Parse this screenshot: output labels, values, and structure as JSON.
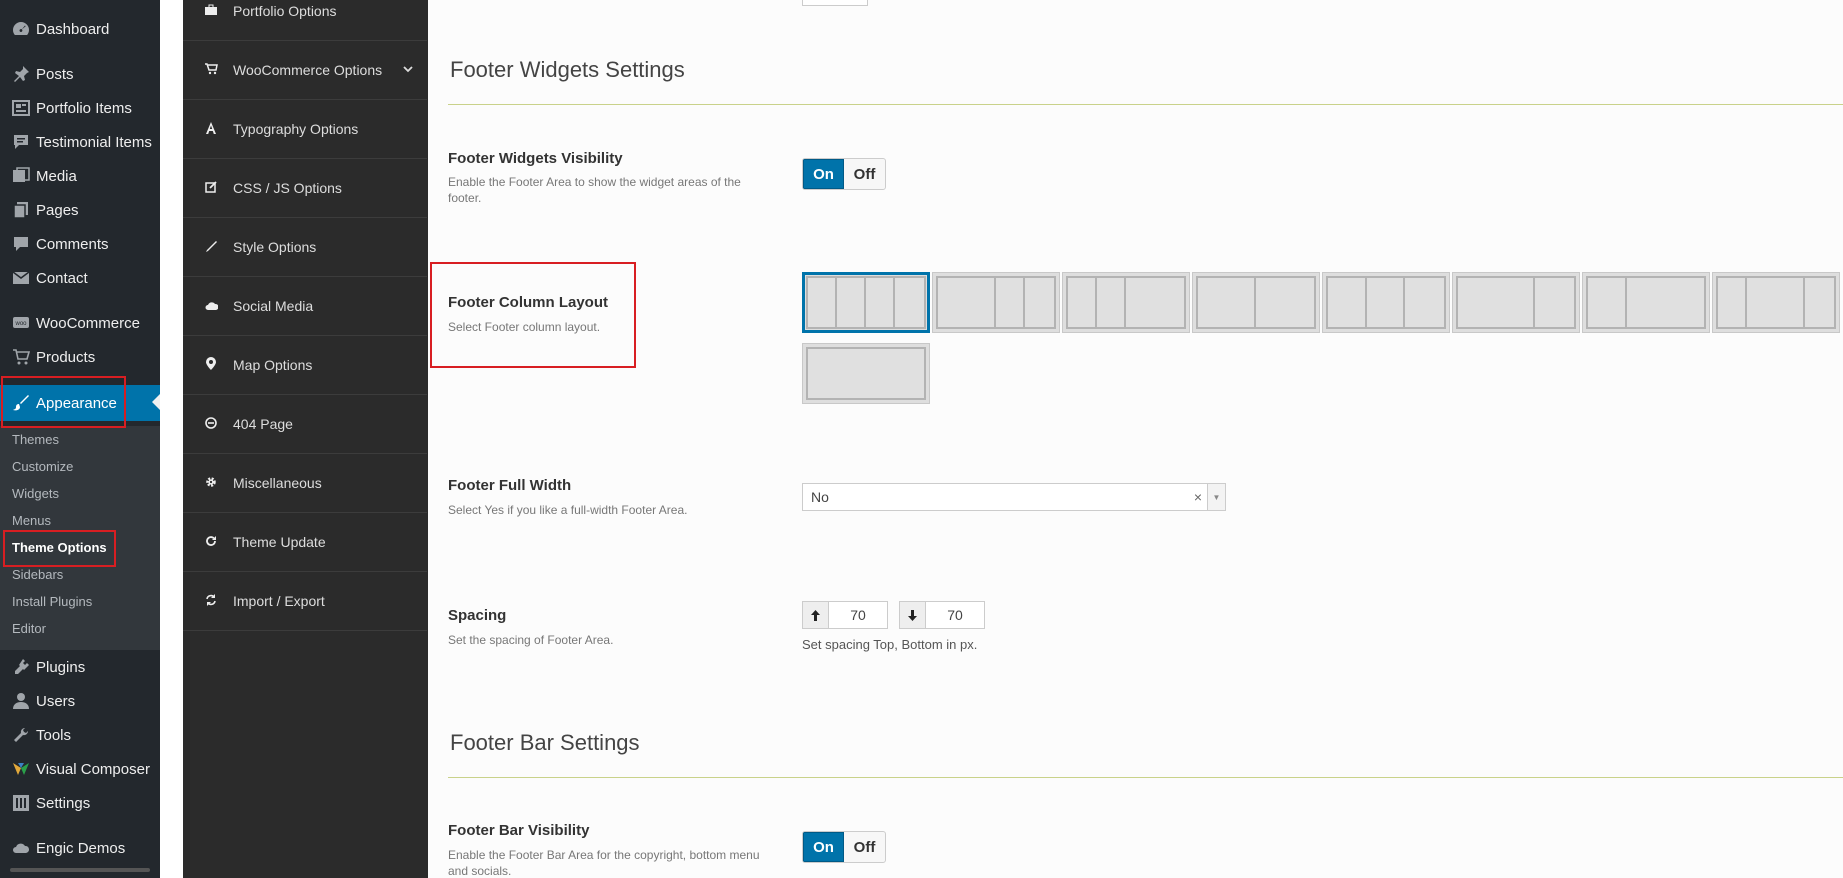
{
  "admin_menu": {
    "items": [
      {
        "label": "Dashboard",
        "icon": "dashboard-icon"
      },
      {
        "label": "Posts",
        "icon": "pin-icon"
      },
      {
        "label": "Portfolio Items",
        "icon": "portfolio-icon"
      },
      {
        "label": "Testimonial Items",
        "icon": "testimonial-icon"
      },
      {
        "label": "Media",
        "icon": "media-icon"
      },
      {
        "label": "Pages",
        "icon": "pages-icon"
      },
      {
        "label": "Comments",
        "icon": "comments-icon"
      },
      {
        "label": "Contact",
        "icon": "mail-icon"
      },
      {
        "label": "WooCommerce",
        "icon": "woo-icon"
      },
      {
        "label": "Products",
        "icon": "cart-icon"
      },
      {
        "label": "Appearance",
        "icon": "brush-icon"
      },
      {
        "label": "Plugins",
        "icon": "plug-icon"
      },
      {
        "label": "Users",
        "icon": "user-icon"
      },
      {
        "label": "Tools",
        "icon": "wrench-icon"
      },
      {
        "label": "Visual Composer",
        "icon": "vc-icon"
      },
      {
        "label": "Settings",
        "icon": "settings-icon"
      },
      {
        "label": "Engic Demos",
        "icon": "cloud-icon"
      }
    ],
    "submenu": [
      "Themes",
      "Customize",
      "Widgets",
      "Menus",
      "Theme Options",
      "Sidebars",
      "Install Plugins",
      "Editor"
    ],
    "active_item": "Appearance",
    "current_sub": "Theme Options"
  },
  "options_nav": [
    {
      "label": "Portfolio Options",
      "icon": "briefcase-icon"
    },
    {
      "label": "WooCommerce Options",
      "icon": "cart-icon",
      "has_children": true
    },
    {
      "label": "Typography Options",
      "icon": "font-icon"
    },
    {
      "label": "CSS / JS Options",
      "icon": "edit-icon"
    },
    {
      "label": "Style Options",
      "icon": "pencil-icon"
    },
    {
      "label": "Social Media",
      "icon": "cloud-icon"
    },
    {
      "label": "Map Options",
      "icon": "map-marker-icon"
    },
    {
      "label": "404 Page",
      "icon": "minus-circle-icon"
    },
    {
      "label": "Miscellaneous",
      "icon": "gear-icon"
    },
    {
      "label": "Theme Update",
      "icon": "refresh-icon"
    },
    {
      "label": "Import / Export",
      "icon": "sync-icon"
    }
  ],
  "sections": {
    "footer_widgets": {
      "title": "Footer Widgets Settings",
      "visibility": {
        "title": "Footer Widgets Visibility",
        "desc": "Enable the Footer Area to show the widget areas of the footer.",
        "on_label": "On",
        "off_label": "Off",
        "value": "On"
      },
      "column_layout": {
        "title": "Footer Column Layout",
        "desc": "Select Footer column layout.",
        "selected_index": 0
      },
      "full_width": {
        "title": "Footer Full Width",
        "desc": "Select Yes if you like a full-width Footer Area.",
        "value": "No",
        "clear_icon": "×",
        "arrow_icon": "▼"
      },
      "spacing": {
        "title": "Spacing",
        "desc": "Set the spacing of Footer Area.",
        "top": "70",
        "bottom": "70",
        "hint": "Set spacing Top, Bottom in px."
      }
    },
    "footer_bar": {
      "title": "Footer Bar Settings",
      "visibility": {
        "title": "Footer Bar Visibility",
        "desc": "Enable the Footer Bar Area for the copyright, bottom menu and socials.",
        "on_label": "On",
        "off_label": "Off",
        "value": "On"
      }
    }
  },
  "colors": {
    "wp_sidebar": "#23282d",
    "accent": "#0073aa",
    "options_nav": "#2b2b2b",
    "highlight": "#d81e22"
  }
}
